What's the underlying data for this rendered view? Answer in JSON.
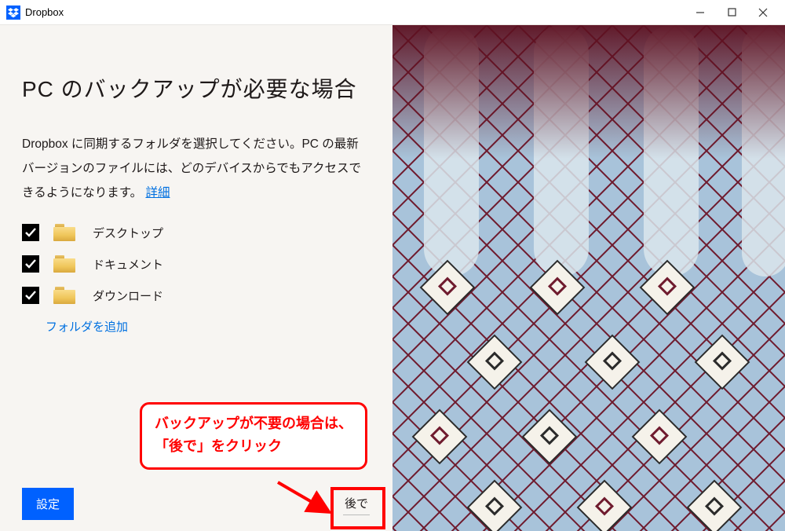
{
  "window": {
    "title": "Dropbox"
  },
  "heading": "PC のバックアップが必要な場合",
  "description": "Dropbox に同期するフォルダを選択してください。PC の最新バージョンのファイルには、どのデバイスからでもアクセスできるようになります。",
  "details_link": "詳細",
  "folders": [
    {
      "label": "デスクトップ"
    },
    {
      "label": "ドキュメント"
    },
    {
      "label": "ダウンロード"
    }
  ],
  "add_folder": "フォルダを追加",
  "buttons": {
    "settings": "設定",
    "later": "後で"
  },
  "annotation": {
    "line1": "バックアップが不要の場合は、",
    "line2": "「後で」をクリック"
  }
}
